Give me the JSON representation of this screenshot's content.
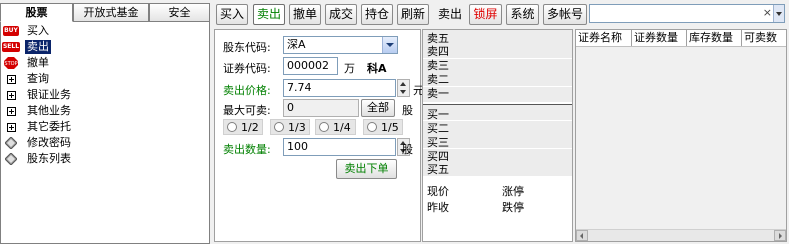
{
  "left_tabs": [
    "股票",
    "开放式基金",
    "安全"
  ],
  "tree": [
    {
      "icon": "buy-icon",
      "badge": "BUY",
      "color": "#d40000",
      "label": "买入"
    },
    {
      "icon": "sell-icon",
      "badge": "SELL",
      "color": "#d40000",
      "label": "卖出"
    },
    {
      "icon": "cancel-order-icon",
      "badge": "STOP",
      "color": "#d40000",
      "label": "撤单"
    },
    {
      "icon": "plus-icon",
      "label": "查询"
    },
    {
      "icon": "plus-icon",
      "label": "银证业务"
    },
    {
      "icon": "plus-icon",
      "label": "其他业务"
    },
    {
      "icon": "plus-icon",
      "label": "其它委托"
    },
    {
      "icon": "diamond-icon",
      "label": "修改密码"
    },
    {
      "icon": "diamond-icon",
      "label": "股东列表"
    }
  ],
  "toolbar": [
    "买入",
    "卖出",
    "撤单",
    "成交",
    "持仓",
    "刷新",
    "卖出",
    "锁屏",
    "系统",
    "多帐号"
  ],
  "top_search": {
    "value": "",
    "clear_glyph": "×"
  },
  "form": {
    "shareholder_label": "股东代码:",
    "shareholder_value": "深A",
    "code_label": "证券代码:",
    "code_value": "000002",
    "code_unit": "万",
    "code_name": "科A",
    "price_label": "卖出价格:",
    "price_value": "7.74",
    "price_unit": "元",
    "max_label": "最大可卖:",
    "max_value": "0",
    "all_button": "全部",
    "max_unit": "股",
    "fractions": [
      "1/2",
      "1/3",
      "1/4",
      "1/5"
    ],
    "qty_label": "卖出数量:",
    "qty_value": "100",
    "qty_unit": "股",
    "submit": "卖出下单"
  },
  "quote": {
    "sell": [
      "卖五",
      "卖四",
      "卖三",
      "卖二",
      "卖一"
    ],
    "buy": [
      "买一",
      "买二",
      "买三",
      "买四",
      "买五"
    ],
    "stats": [
      "现价",
      "涨停",
      "昨收",
      "跌停"
    ]
  },
  "grid": {
    "columns": [
      "证券名称",
      "证券数量",
      "库存数量",
      "可卖数"
    ]
  },
  "colors": {
    "accent_green": "#008000",
    "selected_blue": "#0a246a",
    "lock_red": "#e00000"
  }
}
